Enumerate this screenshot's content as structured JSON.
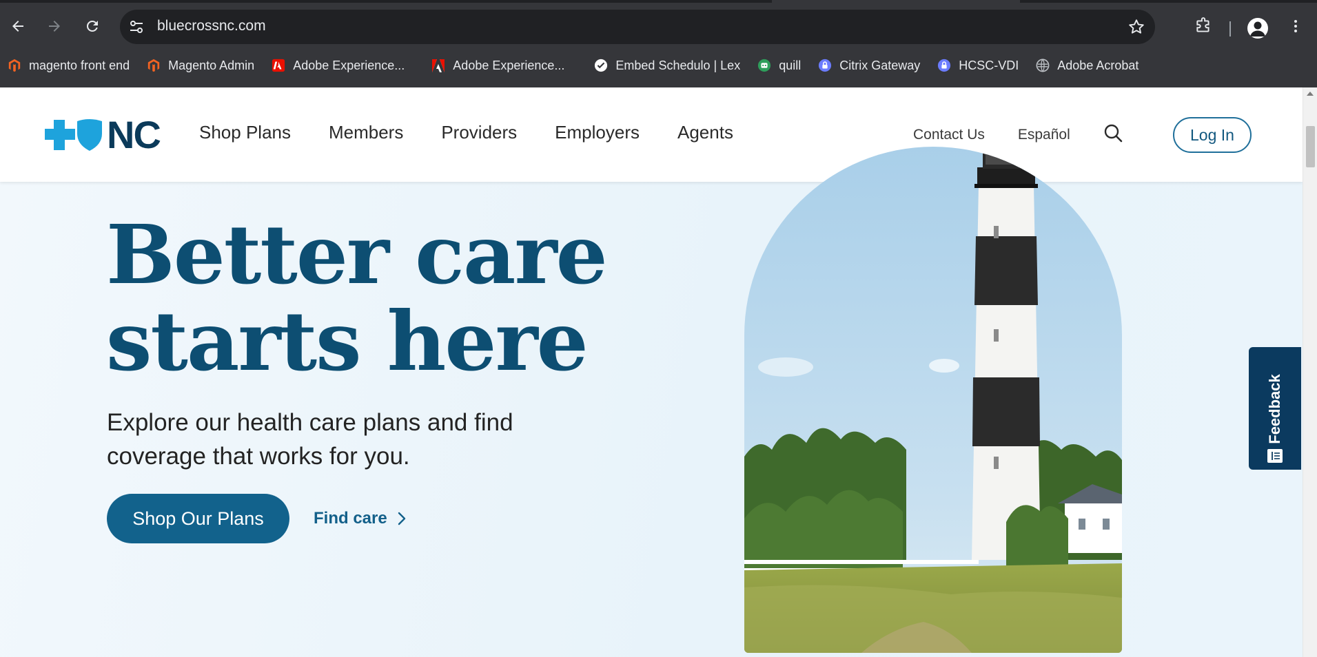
{
  "browser": {
    "url": "bluecrossnc.com",
    "bookmarks": [
      {
        "label": "magento front end",
        "icon": "magento-icon"
      },
      {
        "label": "Magento Admin",
        "icon": "magento-icon"
      },
      {
        "label": "Adobe Experience...",
        "icon": "adobe-icon"
      },
      {
        "label": "Adobe Experience...",
        "icon": "adobe-icon"
      },
      {
        "label": "Embed Schedulo | Lex",
        "icon": "checkmark-icon"
      },
      {
        "label": "quill",
        "icon": "robot-icon"
      },
      {
        "label": "Citrix Gateway",
        "icon": "lock-icon"
      },
      {
        "label": "HCSC-VDI",
        "icon": "lock-icon"
      },
      {
        "label": "Adobe Acrobat",
        "icon": "globe-icon"
      }
    ]
  },
  "header": {
    "logo_text": "NC",
    "nav": [
      "Shop Plans",
      "Members",
      "Providers",
      "Employers",
      "Agents"
    ],
    "contact": "Contact Us",
    "language": "Español",
    "login": "Log In"
  },
  "hero": {
    "title_line1": "Better care",
    "title_line2": "starts here",
    "subtitle": "Explore our health care plans and find coverage that works for you.",
    "cta_primary": "Shop Our Plans",
    "cta_link": "Find care"
  },
  "feedback": {
    "label": "Feedback"
  },
  "colors": {
    "brand_navy": "#0b3a5a",
    "brand_blue": "#12628c",
    "logo_cyan": "#1ea3dc",
    "chrome_bg": "#35363a"
  }
}
